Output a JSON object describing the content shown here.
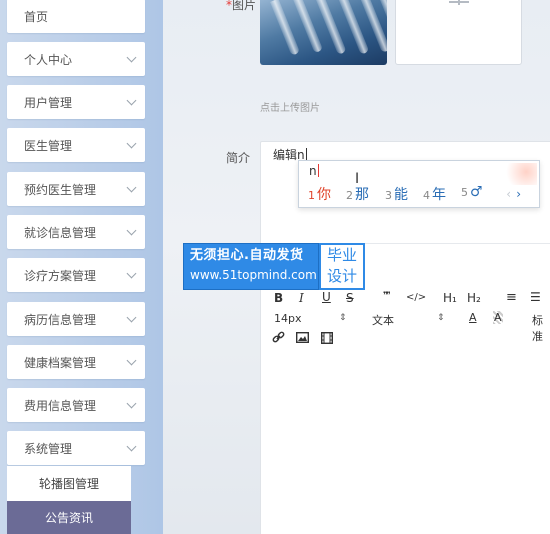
{
  "sidebar": {
    "items": [
      {
        "label": "首页",
        "has_arrow": false
      },
      {
        "label": "个人中心",
        "has_arrow": true
      },
      {
        "label": "用户管理",
        "has_arrow": true
      },
      {
        "label": "医生管理",
        "has_arrow": true
      },
      {
        "label": "预约医生管理",
        "has_arrow": true
      },
      {
        "label": "就诊信息管理",
        "has_arrow": true
      },
      {
        "label": "诊疗方案管理",
        "has_arrow": true
      },
      {
        "label": "病历信息管理",
        "has_arrow": true
      },
      {
        "label": "健康档案管理",
        "has_arrow": true
      },
      {
        "label": "费用信息管理",
        "has_arrow": true
      },
      {
        "label": "系统管理",
        "has_arrow": true
      }
    ],
    "submenu": [
      {
        "label": "轮播图管理",
        "active": false
      },
      {
        "label": "公告资讯",
        "active": true
      }
    ]
  },
  "form": {
    "image_label": "图片",
    "upload_hint": "点击上传图片",
    "intro_label": "简介",
    "editor_text": "编辑n"
  },
  "ime": {
    "pinyin": "n",
    "candidates": [
      {
        "num": "1",
        "text": "你"
      },
      {
        "num": "2",
        "text": "那"
      },
      {
        "num": "3",
        "text": "能"
      },
      {
        "num": "4",
        "text": "年"
      },
      {
        "num": "5",
        "text": "♂"
      }
    ],
    "prev": "‹",
    "next": "›"
  },
  "watermark": {
    "title": "无须担心.自动发货",
    "url": "www.51topmind.com",
    "tag_line1": "毕业",
    "tag_line2": "设计"
  },
  "toolbar": {
    "bold": "B",
    "italic": "I",
    "underline": "U",
    "strike": "S",
    "quote": "❞❞",
    "code": "</>",
    "h1": "H₁",
    "h2": "H₂",
    "ordered_list": "≡",
    "bullet_list": "☰",
    "font_size": "14px",
    "text_type": "文本",
    "font_color": "A",
    "bg_color": "A",
    "align": "标准",
    "arrow": "⇕"
  },
  "colors": {
    "sidebar_bg": "#b9cde8",
    "submenu_active_bg": "#6b6b96",
    "watermark_blue": "#2f8ae6",
    "ime_highlight": "#e0452c",
    "ime_candidate": "#2a6db5"
  }
}
